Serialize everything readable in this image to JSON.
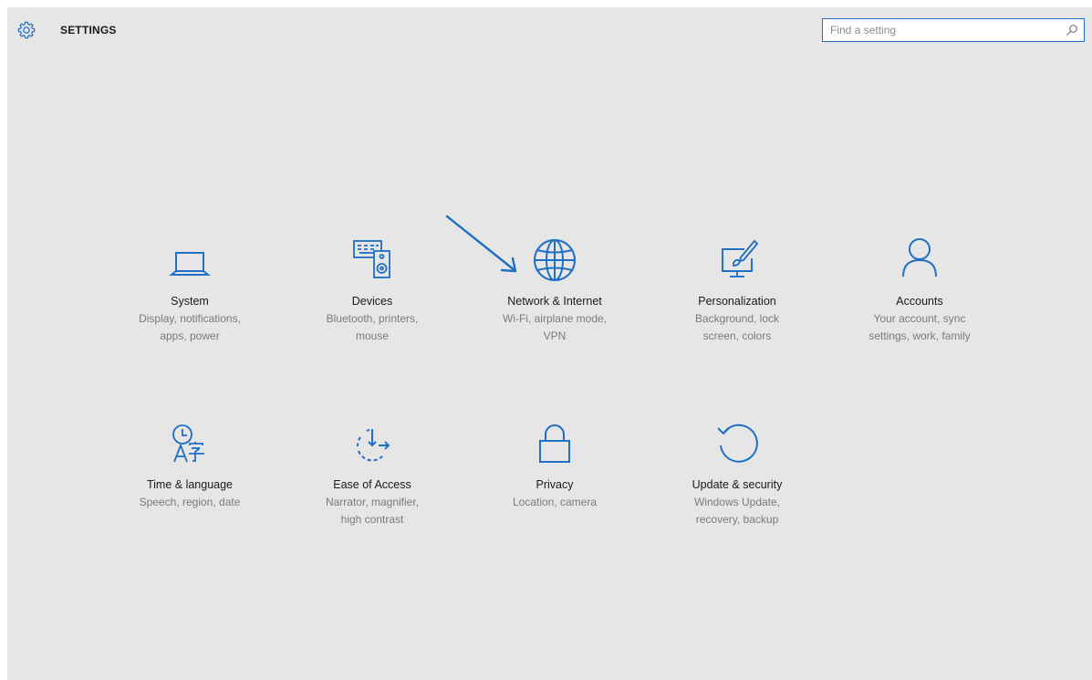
{
  "titlebar": {
    "title": "SETTINGS",
    "icon": "gear-icon"
  },
  "search": {
    "placeholder": "Find a setting",
    "icon": "search-icon"
  },
  "colors": {
    "accent": "#1f6fc5",
    "background": "#e6e6e6",
    "description_text": "#7a7a7a"
  },
  "tiles": [
    {
      "name": "System",
      "description": "Display, notifications,\napps, power",
      "icon": "laptop-icon"
    },
    {
      "name": "Devices",
      "description": "Bluetooth, printers,\nmouse",
      "icon": "keyboard-speaker-icon"
    },
    {
      "name": "Network & Internet",
      "description": "Wi-Fi, airplane mode,\nVPN",
      "icon": "globe-icon"
    },
    {
      "name": "Personalization",
      "description": "Background, lock\nscreen, colors",
      "icon": "paint-monitor-icon"
    },
    {
      "name": "Accounts",
      "description": "Your account, sync\nsettings, work, family",
      "icon": "person-icon"
    },
    {
      "name": "Time & language",
      "description": "Speech, region, date",
      "icon": "clock-language-icon"
    },
    {
      "name": "Ease of Access",
      "description": "Narrator, magnifier,\nhigh contrast",
      "icon": "ease-of-access-icon"
    },
    {
      "name": "Privacy",
      "description": "Location, camera",
      "icon": "lock-icon"
    },
    {
      "name": "Update & security",
      "description": "Windows Update,\nrecovery, backup",
      "icon": "refresh-icon"
    }
  ],
  "annotation": {
    "icon": "arrow-annotation-icon"
  }
}
